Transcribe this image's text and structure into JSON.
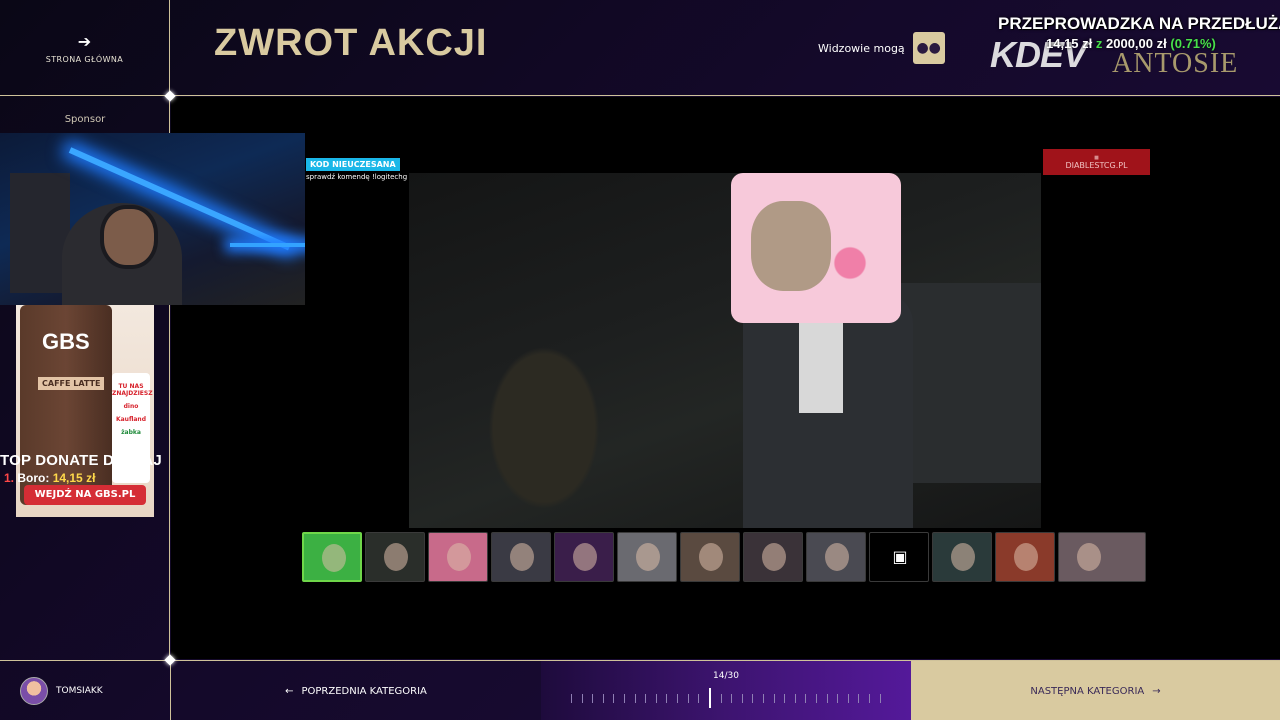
{
  "header": {
    "home_label": "STRONA GŁÓWNA",
    "title": "ZWROT AKCJI",
    "viewers_label": "Widzowie mogą"
  },
  "goal": {
    "headline": "PRZEPROWADZKA NA PRZEDŁUŻANY",
    "current": "14,15 zł",
    "of": "z",
    "target": "2000,00 zł",
    "percent": "(0.71%)",
    "logo_text": "KDEV",
    "overlay_text": "ANTOSIE"
  },
  "sidebar": {
    "sponsor_label": "Sponsor",
    "ad": {
      "brand": "GBS",
      "flavor": "CAFFE LATTE",
      "shops_heading": "TU NAS ZNAJDZIESZ",
      "shops": [
        "dino",
        "Kaufland",
        "żabka"
      ],
      "cta": "WEJDŹ NA GBS.PL"
    },
    "top_donate": {
      "heading": "TOP DONATE DZISIAJ",
      "rank": "1.",
      "name": "Boro:",
      "amount": "14,15 zł"
    }
  },
  "stage": {
    "code_badge": "KOD NIEUCZESANA",
    "code_hint": "sprawdź komendę !logitechg",
    "sponsor_banner": "DIABLESTCG.PL",
    "thumbnails": [
      {
        "active": true,
        "color": "#3cb043"
      },
      {
        "active": false,
        "color": "#2a2e2a"
      },
      {
        "active": false,
        "color": "#c86a8a"
      },
      {
        "active": false,
        "color": "#3a3a44"
      },
      {
        "active": false,
        "color": "#3a1e4a"
      },
      {
        "active": false,
        "color": "#6a6a70"
      },
      {
        "active": false,
        "color": "#5a4a40"
      },
      {
        "active": false,
        "color": "#3a3238"
      },
      {
        "active": false,
        "color": "#4a4a52"
      },
      {
        "active": false,
        "color": "#000000"
      },
      {
        "active": false,
        "color": "#2a3a3a"
      },
      {
        "active": false,
        "color": "#8a3a2a"
      },
      {
        "active": false,
        "color": "#6a5a60"
      }
    ]
  },
  "footer": {
    "username": "TOMSIAKK",
    "prev_label": "POPRZEDNIA KATEGORIA",
    "progress_current": 14,
    "progress_total": 30,
    "progress_label": "14/30",
    "next_label": "NASTĘPNA KATEGORIA"
  }
}
